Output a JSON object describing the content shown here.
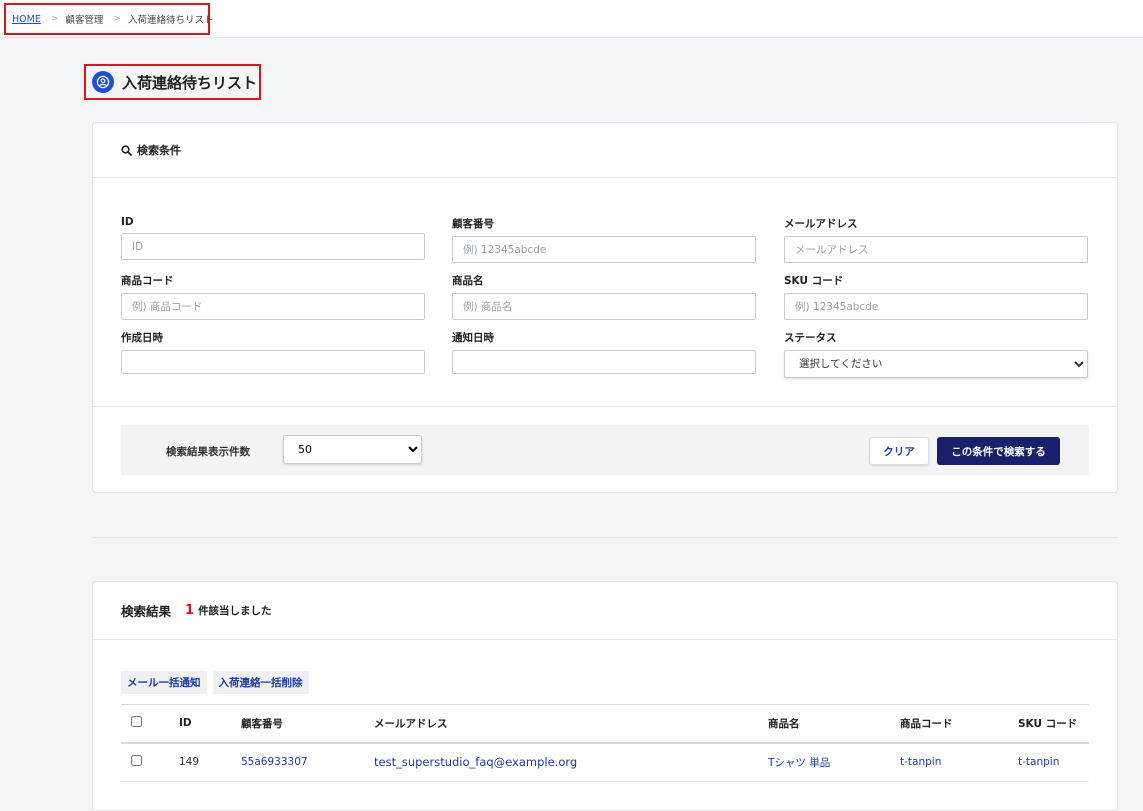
{
  "breadcrumb": {
    "home": "HOME",
    "separator": ">",
    "item1": "顧客管理",
    "current": "入荷連絡待ちリスト"
  },
  "page": {
    "title": "入荷連絡待ちリスト",
    "icon": "user-circle-icon"
  },
  "search": {
    "header": "検索条件",
    "fields": {
      "id": {
        "label": "ID",
        "placeholder": "ID"
      },
      "customer_no": {
        "label": "顧客番号",
        "placeholder": "例) 12345abcde"
      },
      "email": {
        "label": "メールアドレス",
        "placeholder": "メールアドレス"
      },
      "product_code": {
        "label": "商品コード",
        "placeholder": "例) 商品コード"
      },
      "product_name": {
        "label": "商品名",
        "placeholder": "例) 商品名"
      },
      "sku": {
        "label": "SKU コード",
        "placeholder": "例) 12345abcde"
      },
      "created": {
        "label": "作成日時"
      },
      "notified": {
        "label": "通知日時"
      },
      "status": {
        "label": "ステータス",
        "selected": "選択してください"
      }
    },
    "count_label": "検索結果表示件数",
    "count_selected": "50",
    "clear_button": "クリア",
    "search_button": "この条件で検索する"
  },
  "results": {
    "title": "検索結果",
    "count": "1",
    "count_suffix": "件該当しました",
    "bulk_mail": "メール一括通知",
    "bulk_delete": "入荷連絡一括削除",
    "columns": [
      "ID",
      "顧客番号",
      "メールアドレス",
      "商品名",
      "商品コード",
      "SKU コード"
    ],
    "rows": [
      {
        "id": "149",
        "customer_no": "55a6933307",
        "email": "test_superstudio_faq@example.org",
        "product_name": "Tシャツ 単品",
        "product_code": "t-tanpin",
        "sku": "t-tanpin"
      }
    ]
  },
  "colors": {
    "accent": "#1a1f6e",
    "link": "#1d3aa8",
    "highlight_border": "#e0141e",
    "icon_bg": "#1d4fd8"
  }
}
